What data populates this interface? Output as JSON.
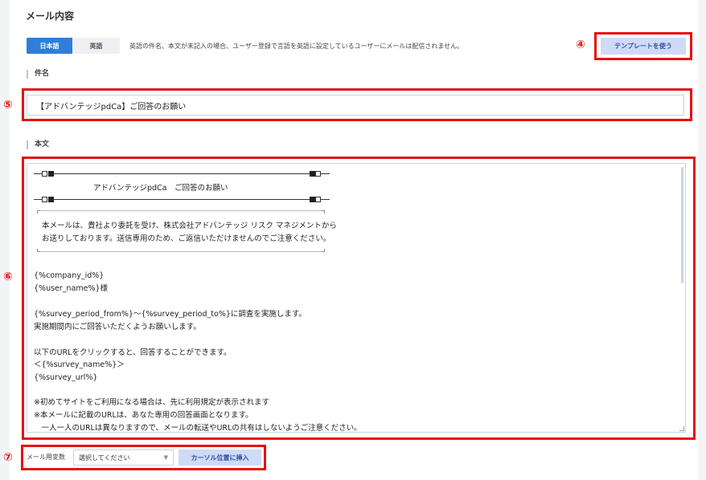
{
  "section": {
    "title": "メール内容"
  },
  "language": {
    "tabs": [
      {
        "label": "日本語",
        "active": true
      },
      {
        "label": "英語",
        "active": false
      }
    ],
    "note": "英語の件名、本文が未記入の場合、ユーザー登録で言語を英語に設定しているユーザーにメールは配信されません。"
  },
  "template": {
    "button_label": "テンプレートを使う"
  },
  "markers": {
    "m4": "④",
    "m5": "⑤",
    "m6": "⑥",
    "m7": "⑦"
  },
  "subject": {
    "label": "件名",
    "value": "【アドバンテッジpdCa】ご回答のお願い"
  },
  "body": {
    "label": "本文",
    "heading": "アドバンテッジpdCa　ご回答のお願い",
    "notice_lines": [
      "本メールは、貴社より委託を受け、株式会社アドバンテッジ リスク マネジメントから",
      "お送りしております。送信専用のため、ご返信いただけませんのでご注意ください。"
    ],
    "lines": [
      "{%company_id%}",
      "{%user_name%}様",
      "",
      "{%survey_period_from%}～{%survey_period_to%}に調査を実施します。",
      "実施期間内にご回答いただくようお願いします。",
      "",
      "以下のURLをクリックすると、回答することができます。",
      "＜{%survey_name%}＞",
      "{%survey_url%}",
      "",
      "※初めてサイトをご利用になる場合は、先に利用規定が表示されます",
      "※本メールに記載のURLは、あなた専用の回答画面となります。",
      "　一人一人のURLは異なりますので、メールの転送やURLの共有はしないようご注意ください。"
    ]
  },
  "variables": {
    "label": "メール用変数",
    "select_value": "選択してください",
    "insert_label": "カーソル位置に挿入"
  },
  "colors": {
    "accent": "#2f7fd8",
    "button_bg": "#cfdaf6",
    "button_text": "#2e4fa3",
    "highlight_red": "#e41010"
  }
}
